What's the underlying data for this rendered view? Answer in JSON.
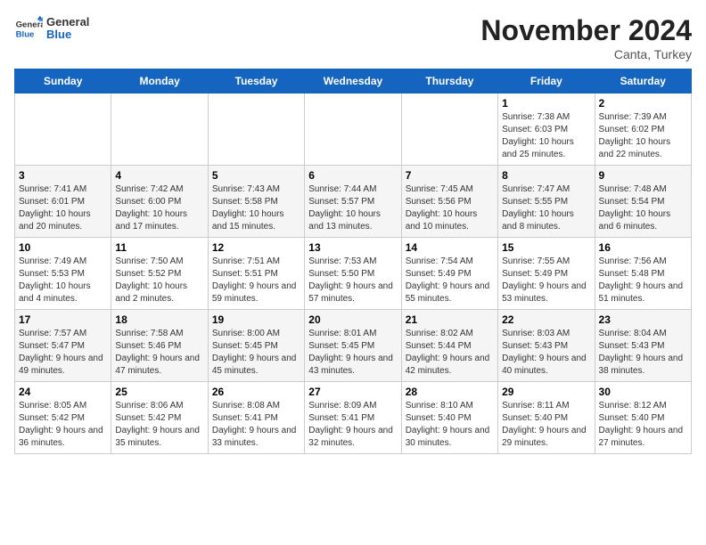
{
  "header": {
    "logo": {
      "general": "General",
      "blue": "Blue"
    },
    "title": "November 2024",
    "location": "Canta, Turkey"
  },
  "days_of_week": [
    "Sunday",
    "Monday",
    "Tuesday",
    "Wednesday",
    "Thursday",
    "Friday",
    "Saturday"
  ],
  "weeks": [
    [
      {
        "day": "",
        "info": ""
      },
      {
        "day": "",
        "info": ""
      },
      {
        "day": "",
        "info": ""
      },
      {
        "day": "",
        "info": ""
      },
      {
        "day": "",
        "info": ""
      },
      {
        "day": "1",
        "info": "Sunrise: 7:38 AM\nSunset: 6:03 PM\nDaylight: 10 hours and 25 minutes."
      },
      {
        "day": "2",
        "info": "Sunrise: 7:39 AM\nSunset: 6:02 PM\nDaylight: 10 hours and 22 minutes."
      }
    ],
    [
      {
        "day": "3",
        "info": "Sunrise: 7:41 AM\nSunset: 6:01 PM\nDaylight: 10 hours and 20 minutes."
      },
      {
        "day": "4",
        "info": "Sunrise: 7:42 AM\nSunset: 6:00 PM\nDaylight: 10 hours and 17 minutes."
      },
      {
        "day": "5",
        "info": "Sunrise: 7:43 AM\nSunset: 5:58 PM\nDaylight: 10 hours and 15 minutes."
      },
      {
        "day": "6",
        "info": "Sunrise: 7:44 AM\nSunset: 5:57 PM\nDaylight: 10 hours and 13 minutes."
      },
      {
        "day": "7",
        "info": "Sunrise: 7:45 AM\nSunset: 5:56 PM\nDaylight: 10 hours and 10 minutes."
      },
      {
        "day": "8",
        "info": "Sunrise: 7:47 AM\nSunset: 5:55 PM\nDaylight: 10 hours and 8 minutes."
      },
      {
        "day": "9",
        "info": "Sunrise: 7:48 AM\nSunset: 5:54 PM\nDaylight: 10 hours and 6 minutes."
      }
    ],
    [
      {
        "day": "10",
        "info": "Sunrise: 7:49 AM\nSunset: 5:53 PM\nDaylight: 10 hours and 4 minutes."
      },
      {
        "day": "11",
        "info": "Sunrise: 7:50 AM\nSunset: 5:52 PM\nDaylight: 10 hours and 2 minutes."
      },
      {
        "day": "12",
        "info": "Sunrise: 7:51 AM\nSunset: 5:51 PM\nDaylight: 9 hours and 59 minutes."
      },
      {
        "day": "13",
        "info": "Sunrise: 7:53 AM\nSunset: 5:50 PM\nDaylight: 9 hours and 57 minutes."
      },
      {
        "day": "14",
        "info": "Sunrise: 7:54 AM\nSunset: 5:49 PM\nDaylight: 9 hours and 55 minutes."
      },
      {
        "day": "15",
        "info": "Sunrise: 7:55 AM\nSunset: 5:49 PM\nDaylight: 9 hours and 53 minutes."
      },
      {
        "day": "16",
        "info": "Sunrise: 7:56 AM\nSunset: 5:48 PM\nDaylight: 9 hours and 51 minutes."
      }
    ],
    [
      {
        "day": "17",
        "info": "Sunrise: 7:57 AM\nSunset: 5:47 PM\nDaylight: 9 hours and 49 minutes."
      },
      {
        "day": "18",
        "info": "Sunrise: 7:58 AM\nSunset: 5:46 PM\nDaylight: 9 hours and 47 minutes."
      },
      {
        "day": "19",
        "info": "Sunrise: 8:00 AM\nSunset: 5:45 PM\nDaylight: 9 hours and 45 minutes."
      },
      {
        "day": "20",
        "info": "Sunrise: 8:01 AM\nSunset: 5:45 PM\nDaylight: 9 hours and 43 minutes."
      },
      {
        "day": "21",
        "info": "Sunrise: 8:02 AM\nSunset: 5:44 PM\nDaylight: 9 hours and 42 minutes."
      },
      {
        "day": "22",
        "info": "Sunrise: 8:03 AM\nSunset: 5:43 PM\nDaylight: 9 hours and 40 minutes."
      },
      {
        "day": "23",
        "info": "Sunrise: 8:04 AM\nSunset: 5:43 PM\nDaylight: 9 hours and 38 minutes."
      }
    ],
    [
      {
        "day": "24",
        "info": "Sunrise: 8:05 AM\nSunset: 5:42 PM\nDaylight: 9 hours and 36 minutes."
      },
      {
        "day": "25",
        "info": "Sunrise: 8:06 AM\nSunset: 5:42 PM\nDaylight: 9 hours and 35 minutes."
      },
      {
        "day": "26",
        "info": "Sunrise: 8:08 AM\nSunset: 5:41 PM\nDaylight: 9 hours and 33 minutes."
      },
      {
        "day": "27",
        "info": "Sunrise: 8:09 AM\nSunset: 5:41 PM\nDaylight: 9 hours and 32 minutes."
      },
      {
        "day": "28",
        "info": "Sunrise: 8:10 AM\nSunset: 5:40 PM\nDaylight: 9 hours and 30 minutes."
      },
      {
        "day": "29",
        "info": "Sunrise: 8:11 AM\nSunset: 5:40 PM\nDaylight: 9 hours and 29 minutes."
      },
      {
        "day": "30",
        "info": "Sunrise: 8:12 AM\nSunset: 5:40 PM\nDaylight: 9 hours and 27 minutes."
      }
    ]
  ]
}
